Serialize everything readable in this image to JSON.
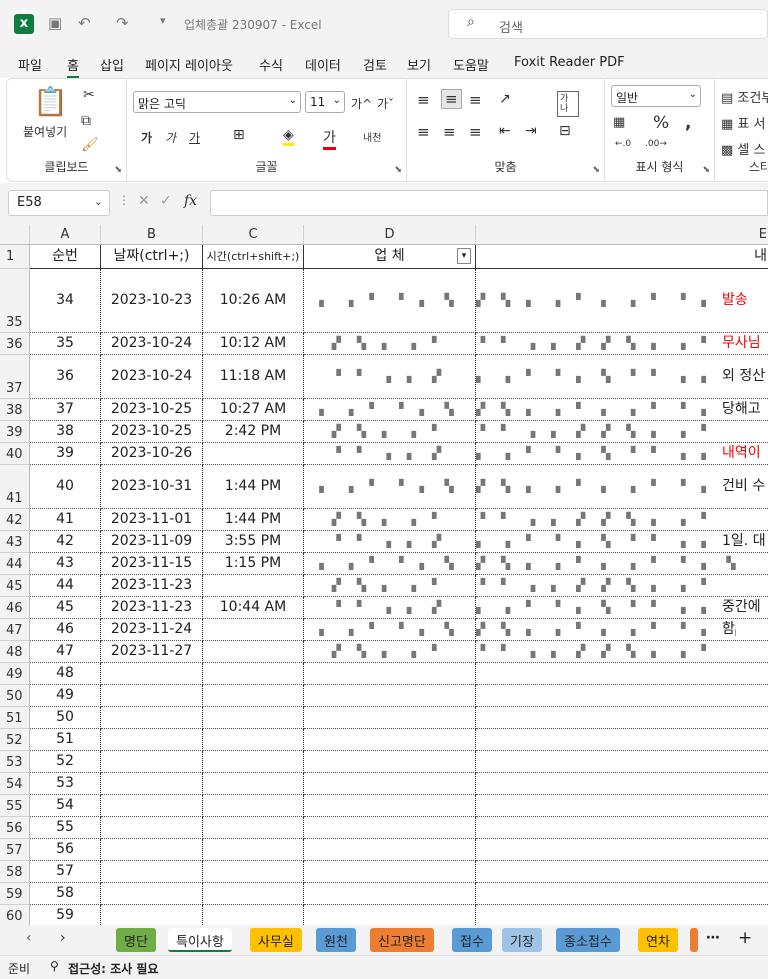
{
  "titlebar": {
    "title": "업체총괄 230907  -  Excel",
    "search_placeholder": "검색"
  },
  "menu": [
    "파일",
    "홈",
    "삽입",
    "페이지 레이아웃",
    "수식",
    "데이터",
    "검토",
    "보기",
    "도움말",
    "Foxit Reader PDF"
  ],
  "ribbon": {
    "clipboard": {
      "paste": "붙여넣기",
      "label": "클립보드"
    },
    "font": {
      "name": "맑은 고딕",
      "size": "11",
      "label": "글꼴",
      "grow": "가^",
      "shrink": "가ˇ",
      "bold": "가",
      "italic": "가",
      "underline": "가",
      "fontcolor": "가",
      "phonetic": "내천"
    },
    "alignment": {
      "label": "맞춤",
      "wrap": "가나"
    },
    "number": {
      "format": "일반",
      "label": "표시 형식"
    },
    "styles": {
      "cond": "조건부",
      "table": "표 서",
      "cell": "셀 스",
      "label": "스타"
    }
  },
  "formula_bar": {
    "name_box": "E58",
    "fx": "fx",
    "value": ""
  },
  "grid": {
    "columns": [
      "A",
      "B",
      "C",
      "D",
      "E"
    ],
    "headers": {
      "row_num": "1",
      "a": "순번",
      "b": "날짜(ctrl+;)",
      "c": "시간(ctrl+shift+;)",
      "d": "업    체",
      "e": "내"
    },
    "rows": [
      {
        "num": "35",
        "a": "34",
        "b": "2023-10-23",
        "c": "10:26 AM",
        "e": " 발송"
      },
      {
        "num": "36",
        "a": "35",
        "b": "2023-10-24",
        "c": "10:12 AM",
        "e": "무사님"
      },
      {
        "num": "37",
        "a": "36",
        "b": "2023-10-24",
        "c": "11:18 AM",
        "e": "외 정산"
      },
      {
        "num": "38",
        "a": "37",
        "b": "2023-10-25",
        "c": "10:27 AM",
        "e": "당해고"
      },
      {
        "num": "39",
        "a": "38",
        "b": "2023-10-25",
        "c": "2:42 PM",
        "e": ""
      },
      {
        "num": "40",
        "a": "39",
        "b": "2023-10-26",
        "c": "",
        "e": "내역이"
      },
      {
        "num": "41",
        "a": "40",
        "b": "2023-10-31",
        "c": "1:44 PM",
        "e": "건비 수"
      },
      {
        "num": "42",
        "a": "41",
        "b": "2023-11-01",
        "c": "1:44 PM",
        "e": ""
      },
      {
        "num": "43",
        "a": "42",
        "b": "2023-11-09",
        "c": "3:55 PM",
        "e": "1일. 대"
      },
      {
        "num": "44",
        "a": "43",
        "b": "2023-11-15",
        "c": "1:15 PM",
        "e": ""
      },
      {
        "num": "45",
        "a": "44",
        "b": "2023-11-23",
        "c": "",
        "e": ""
      },
      {
        "num": "46",
        "a": "45",
        "b": "2023-11-23",
        "c": "10:44 AM",
        "e": "중간에"
      },
      {
        "num": "47",
        "a": "46",
        "b": "2023-11-24",
        "c": "",
        "e": "함"
      },
      {
        "num": "48",
        "a": "47",
        "b": "2023-11-27",
        "c": "",
        "e": ""
      },
      {
        "num": "49",
        "a": "48",
        "b": "",
        "c": "",
        "e": ""
      },
      {
        "num": "50",
        "a": "49",
        "b": "",
        "c": "",
        "e": ""
      },
      {
        "num": "51",
        "a": "50",
        "b": "",
        "c": "",
        "e": ""
      },
      {
        "num": "52",
        "a": "51",
        "b": "",
        "c": "",
        "e": ""
      },
      {
        "num": "53",
        "a": "52",
        "b": "",
        "c": "",
        "e": ""
      },
      {
        "num": "54",
        "a": "53",
        "b": "",
        "c": "",
        "e": ""
      },
      {
        "num": "55",
        "a": "54",
        "b": "",
        "c": "",
        "e": ""
      },
      {
        "num": "56",
        "a": "55",
        "b": "",
        "c": "",
        "e": ""
      },
      {
        "num": "57",
        "a": "56",
        "b": "",
        "c": "",
        "e": ""
      },
      {
        "num": "58",
        "a": "57",
        "b": "",
        "c": "",
        "e": ""
      },
      {
        "num": "59",
        "a": "58",
        "b": "",
        "c": "",
        "e": ""
      },
      {
        "num": "60",
        "a": "59",
        "b": "",
        "c": "",
        "e": ""
      }
    ]
  },
  "sheet_tabs": [
    {
      "label": "명단",
      "color": "#70ad47"
    },
    {
      "label": "특이사항",
      "color": "#ffffff"
    },
    {
      "label": "사무실",
      "color": "#ffc000"
    },
    {
      "label": "원천",
      "color": "#5b9bd5"
    },
    {
      "label": "신고명단",
      "color": "#ed7d31"
    },
    {
      "label": "접수",
      "color": "#5b9bd5"
    },
    {
      "label": "기장",
      "color": "#9dc3e6"
    },
    {
      "label": "종소접수",
      "color": "#5b9bd5"
    },
    {
      "label": "연차",
      "color": "#ffc000"
    }
  ],
  "status": {
    "ready": "준비",
    "accessibility": "접근성: 조사 필요"
  }
}
